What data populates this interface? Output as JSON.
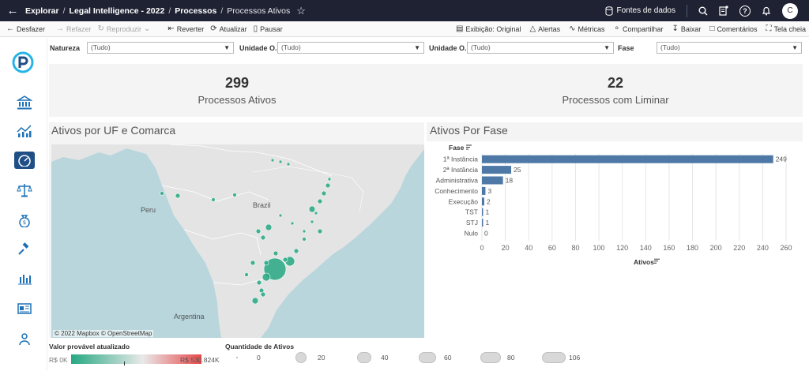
{
  "nav": {
    "breadcrumbs": [
      "Explorar",
      "Legal Intelligence - 2022",
      "Processos",
      "Processos Ativos"
    ],
    "data_sources": "Fontes de dados",
    "avatar_initial": "C"
  },
  "toolbar": {
    "undo": "Desfazer",
    "redo": "Refazer",
    "replay": "Reproduzir",
    "revert": "Reverter",
    "refresh": "Atualizar",
    "pause": "Pausar",
    "view": "Exibição: Original",
    "alerts": "Alertas",
    "metrics": "Métricas",
    "share": "Compartilhar",
    "download": "Baixar",
    "comments": "Comentários",
    "fullscreen": "Tela cheia"
  },
  "filters": [
    {
      "label": "Natureza",
      "value": "(Tudo)"
    },
    {
      "label": "Unidade O...",
      "value": "(Tudo)"
    },
    {
      "label": "Unidade O...",
      "value": "(Tudo)"
    },
    {
      "label": "Fase",
      "value": "(Tudo)"
    }
  ],
  "kpis": [
    {
      "value": "299",
      "label": "Processos Ativos"
    },
    {
      "value": "22",
      "label": "Processos com Liminar"
    }
  ],
  "map": {
    "title": "Ativos por UF e Comarca",
    "attribution": "© 2022 Mapbox  © OpenStreetMap",
    "labels": [
      "Peru",
      "Brazil",
      "Argentina"
    ]
  },
  "legend_color": {
    "title": "Valor provável atualizado",
    "min": "R$ 0K",
    "max": "R$ 530.824K",
    "colors": {
      "low": "#27a882",
      "mid": "#e9e9e9",
      "high": "#e8484a"
    }
  },
  "legend_size": {
    "title": "Quantidade de Ativos",
    "values": [
      "0",
      "20",
      "40",
      "60",
      "80",
      "106"
    ]
  },
  "chart_data": {
    "type": "bar",
    "orientation": "horizontal",
    "title": "Ativos Por Fase",
    "ylabel": "Fase",
    "xlabel": "Ativos",
    "categories": [
      "1ª Instância",
      "2ª Instância",
      "Administrativa",
      "Conhecimento",
      "Execução",
      "TST",
      "STJ",
      "Nulo"
    ],
    "values": [
      249,
      25,
      18,
      3,
      2,
      1,
      1,
      0
    ],
    "xlim": [
      0,
      260
    ],
    "xticks": [
      0,
      20,
      40,
      60,
      80,
      100,
      120,
      140,
      160,
      180,
      200,
      220,
      240,
      260
    ],
    "grid": true,
    "bar_color": "#4e79a7"
  }
}
